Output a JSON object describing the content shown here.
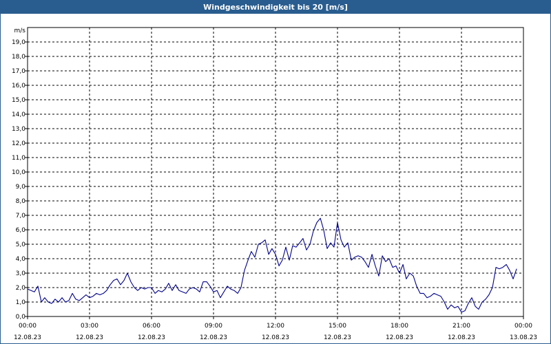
{
  "title": "Windgeschwindigkeit bis 20 [m/s]",
  "chart_data": {
    "type": "line",
    "title": "Windgeschwindigkeit bis 20 [m/s]",
    "ylabel": "m/s",
    "ylim": [
      0,
      20
    ],
    "y_ticks": [
      "0,0",
      "1,0",
      "2,0",
      "3,0",
      "4,0",
      "5,0",
      "6,0",
      "7,0",
      "8,0",
      "9,0",
      "10,0",
      "11,0",
      "12,0",
      "13,0",
      "14,0",
      "15,0",
      "16,0",
      "17,0",
      "18,0",
      "19,0"
    ],
    "x_ticks": [
      {
        "time": "00:00",
        "date": "12.08.23"
      },
      {
        "time": "03:00",
        "date": "12.08.23"
      },
      {
        "time": "06:00",
        "date": "12.08.23"
      },
      {
        "time": "09:00",
        "date": "12.08.23"
      },
      {
        "time": "12:00",
        "date": "12.08.23"
      },
      {
        "time": "15:00",
        "date": "12.08.23"
      },
      {
        "time": "18:00",
        "date": "12.08.23"
      },
      {
        "time": "21:00",
        "date": "12.08.23"
      },
      {
        "time": "00:00",
        "date": "13.08.23"
      }
    ],
    "grid": true,
    "line_color": "#00008b",
    "series": [
      {
        "x_hours": [
          0,
          0.17,
          0.33,
          0.5,
          0.67,
          0.83,
          1,
          1.17,
          1.33,
          1.5,
          1.67,
          1.83,
          2,
          2.17,
          2.33,
          2.5,
          2.67,
          2.83,
          3,
          3.17,
          3.33,
          3.5,
          3.67,
          3.83,
          4,
          4.17,
          4.33,
          4.5,
          4.67,
          4.83,
          5,
          5.17,
          5.33,
          5.5,
          5.67,
          5.83,
          6,
          6.17,
          6.33,
          6.5,
          6.67,
          6.83,
          7,
          7.17,
          7.33,
          7.5,
          7.67,
          7.83,
          8,
          8.17,
          8.33,
          8.5,
          8.67,
          8.83,
          9,
          9.17,
          9.33,
          9.5,
          9.67,
          9.83,
          10,
          10.17,
          10.33,
          10.5,
          10.67,
          10.83,
          11,
          11.17,
          11.33,
          11.5,
          11.67,
          11.83,
          12,
          12.17,
          12.33,
          12.5,
          12.67,
          12.83,
          13,
          13.17,
          13.33,
          13.5,
          13.67,
          13.83,
          14,
          14.17,
          14.33,
          14.5,
          14.67,
          14.83,
          15,
          15.17,
          15.33,
          15.5,
          15.67,
          15.83,
          16,
          16.17,
          16.33,
          16.5,
          16.67,
          16.83,
          17,
          17.17,
          17.33,
          17.5,
          17.67,
          17.83,
          18,
          18.17,
          18.33,
          18.5,
          18.67,
          18.83,
          19,
          19.17,
          19.33,
          19.5,
          19.67,
          19.83,
          20,
          20.17,
          20.33,
          20.5,
          20.67,
          20.83,
          21,
          21.17,
          21.33,
          21.5,
          21.67,
          21.83,
          22,
          22.17,
          22.33,
          22.5,
          22.67,
          22.83,
          23,
          23.17,
          23.33,
          23.5,
          23.67,
          23.83,
          24
        ],
        "values": [
          1.9,
          1.8,
          1.7,
          2.1,
          1.0,
          1.3,
          1.0,
          0.9,
          1.2,
          1.0,
          1.3,
          1.0,
          1.1,
          1.6,
          1.2,
          1.1,
          1.3,
          1.5,
          1.3,
          1.4,
          1.6,
          1.5,
          1.6,
          1.8,
          2.2,
          2.5,
          2.6,
          2.2,
          2.5,
          3.0,
          2.4,
          2.0,
          1.8,
          2.0,
          1.9,
          2.0,
          2.0,
          1.6,
          1.8,
          1.7,
          1.9,
          2.3,
          1.8,
          2.2,
          1.8,
          1.7,
          1.6,
          1.9,
          2.0,
          1.9,
          1.7,
          2.4,
          2.4,
          2.1,
          1.7,
          1.8,
          1.3,
          1.7,
          2.1,
          1.9,
          1.8,
          1.6,
          2.0,
          3.2,
          3.9,
          4.5,
          4.1,
          5.0,
          5.1,
          5.3,
          4.3,
          4.7,
          4.3,
          3.5,
          3.9,
          4.8,
          3.9,
          4.9,
          4.8,
          5.1,
          5.4,
          4.6,
          5.0,
          5.9,
          6.5,
          6.8,
          6.0,
          4.7,
          5.1,
          4.8,
          6.5,
          5.3,
          4.8,
          5.1,
          3.9,
          4.1,
          4.2,
          4.1,
          3.8,
          3.4,
          4.3,
          3.5,
          2.8,
          4.2,
          3.8,
          4.0,
          3.4,
          3.5,
          3.0,
          3.6,
          2.6,
          3.0,
          2.8,
          2.1,
          1.6,
          1.6,
          1.3,
          1.4,
          1.6,
          1.5,
          1.4,
          1.0,
          0.5,
          0.8,
          0.6,
          0.7,
          0.3,
          0.4,
          0.9,
          1.3,
          0.7,
          0.5,
          1.0,
          1.2,
          1.5,
          2.0,
          3.4,
          3.3,
          3.4,
          3.6,
          3.2,
          2.6,
          3.3
        ]
      }
    ]
  }
}
